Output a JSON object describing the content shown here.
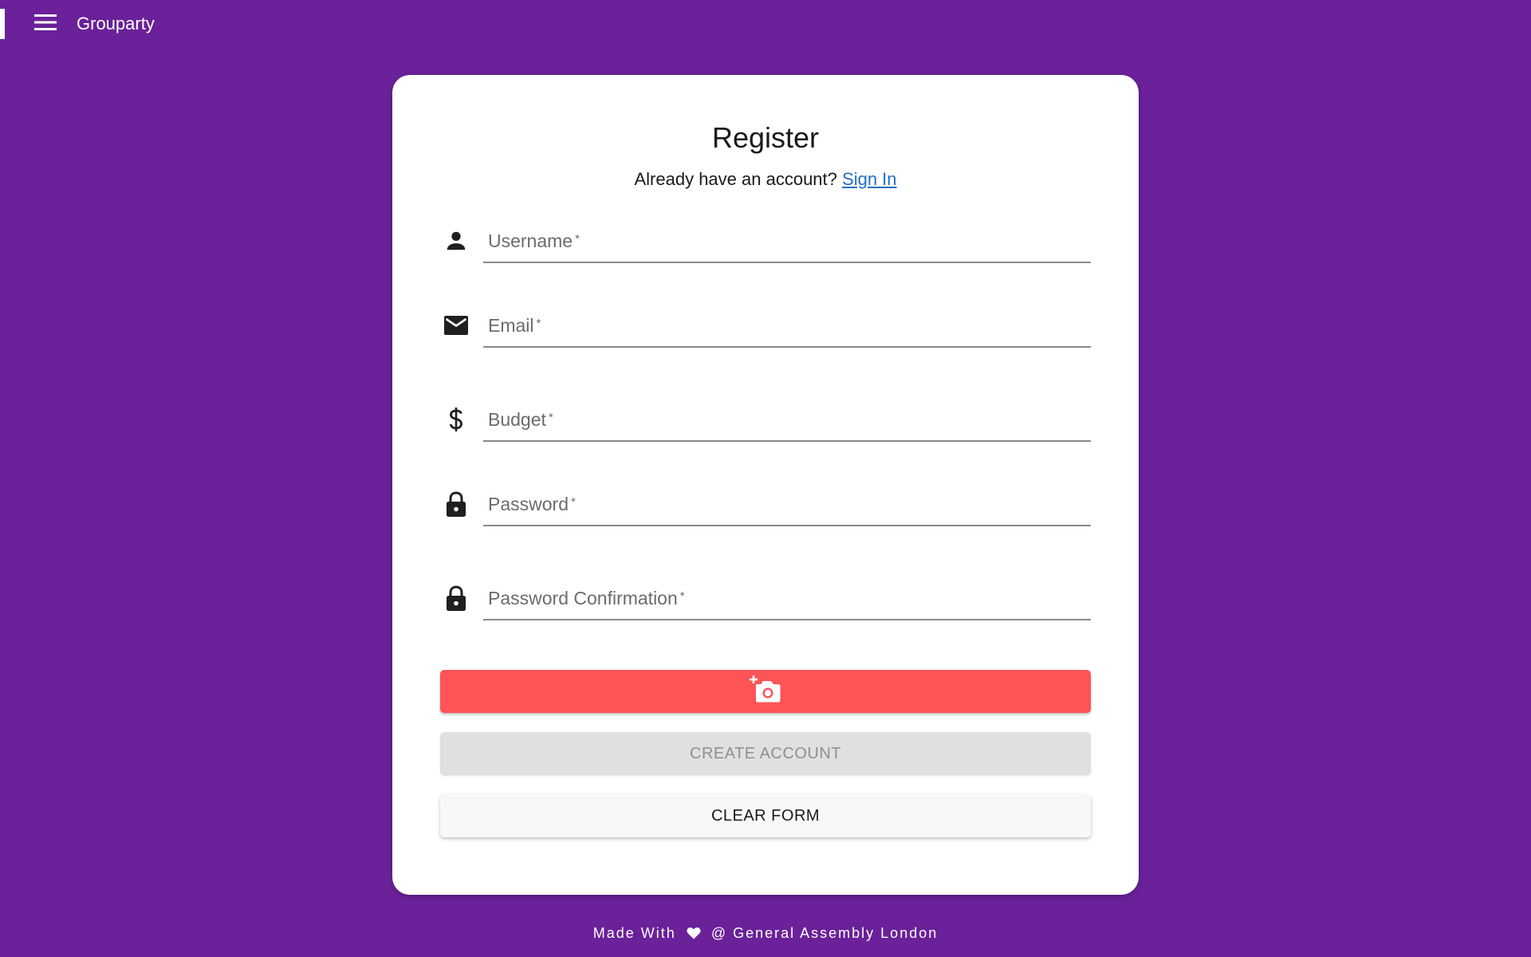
{
  "app": {
    "title": "Grouparty"
  },
  "register": {
    "title": "Register",
    "subtitle": "Already have an account?",
    "signin_link": "Sign In"
  },
  "fields": {
    "username": {
      "label": "Username",
      "required_mark": "*",
      "value": "",
      "icon": "person-icon"
    },
    "email": {
      "label": "Email",
      "required_mark": "*",
      "value": "",
      "icon": "mail-icon"
    },
    "budget": {
      "label": "Budget",
      "required_mark": "*",
      "value": "",
      "icon": "dollar-icon"
    },
    "password": {
      "label": "Password",
      "required_mark": "*",
      "value": "",
      "icon": "lock-icon"
    },
    "password_confirmation": {
      "label": "Password Confirmation",
      "required_mark": "*",
      "value": "",
      "icon": "lock-icon"
    }
  },
  "buttons": {
    "photo_icon": "add-photo-icon",
    "create_account": "CREATE ACCOUNT",
    "clear_form": "CLEAR FORM"
  },
  "footer": {
    "prefix": "Made With",
    "suffix": "@ General Assembly London"
  },
  "colors": {
    "background": "#6a2199",
    "photo_button": "#fc5457",
    "disabled_button": "#e0e0e0",
    "link": "#1f6fc4"
  }
}
